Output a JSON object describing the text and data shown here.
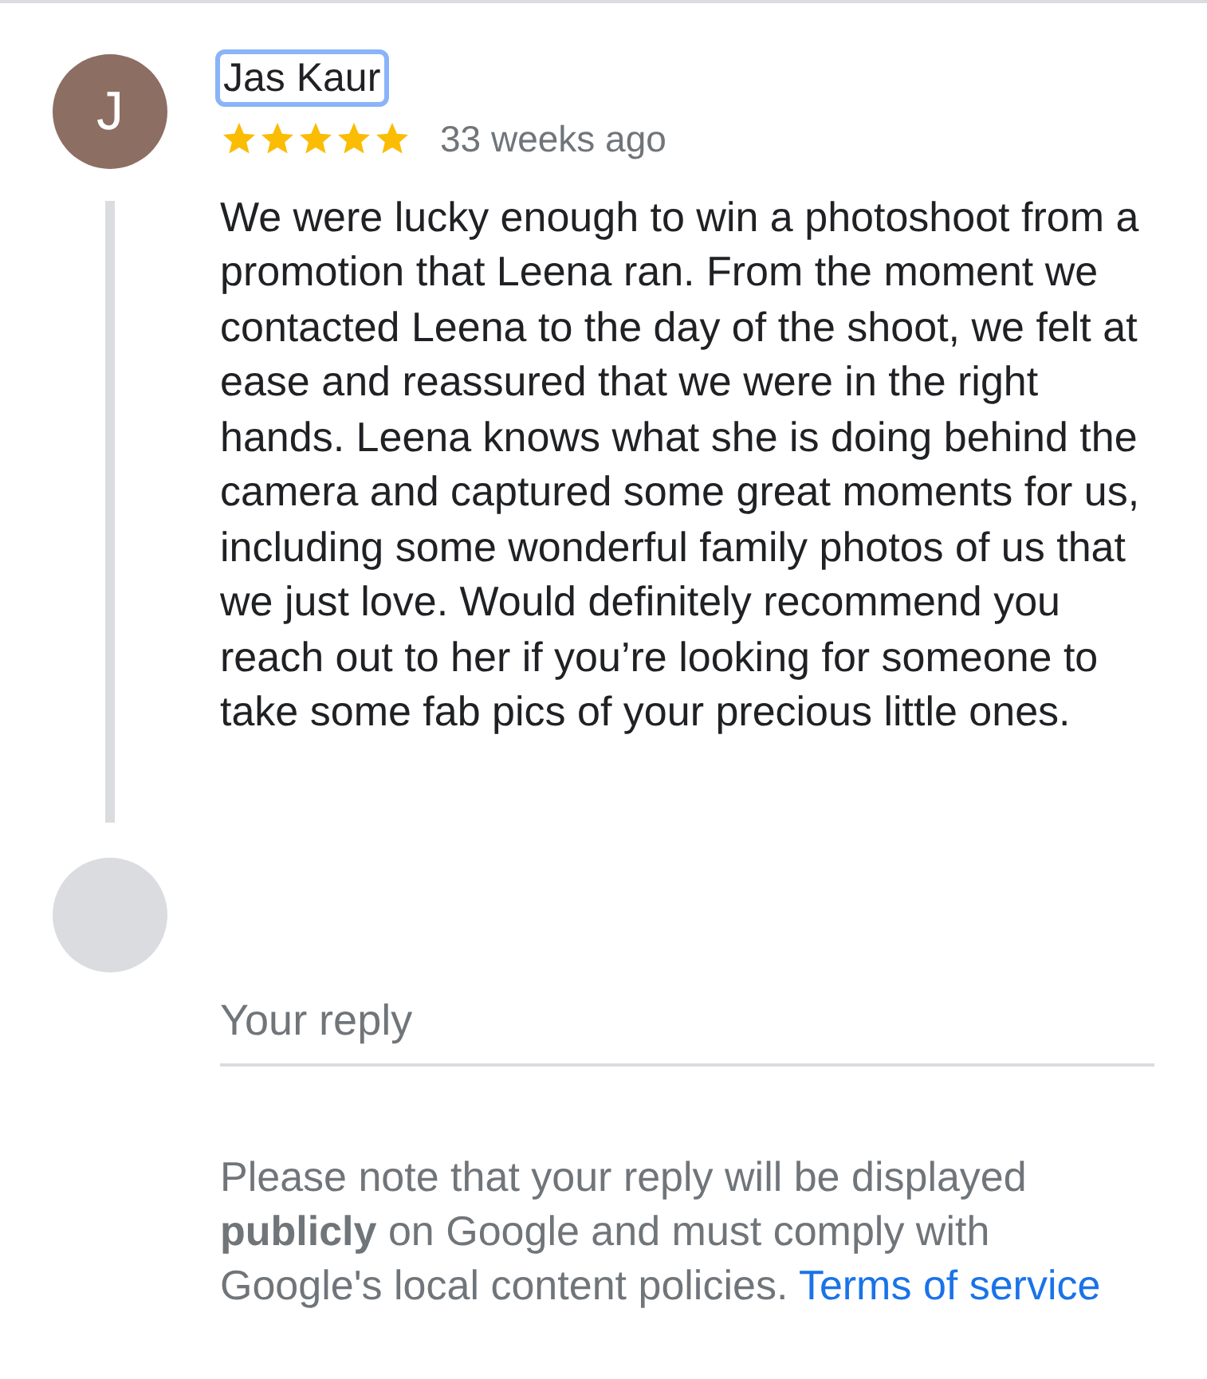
{
  "review": {
    "avatar_letter": "J",
    "name": "Jas Kaur",
    "name_focused": true,
    "stars": 5,
    "time": "33 weeks ago",
    "text": "We were lucky enough to win a photoshoot from a promotion that Leena ran. From the moment we contacted Leena to the day of the shoot, we felt at ease and reassured that we were in the right hands. Leena knows what she is doing behind the camera and captured some great moments for us, including some wonderful family photos of us that we just love. Would definitely recommend you reach out to her if you’re looking for someone to take some fab pics of your precious little ones."
  },
  "reply": {
    "placeholder": "Your reply",
    "note": "Please note that your reply will be displayed **publicly** on Google and must comply with Google's local content policies.",
    "link": "Terms of service"
  }
}
